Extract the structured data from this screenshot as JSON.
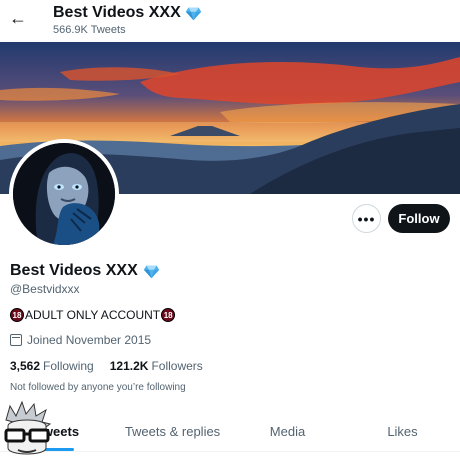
{
  "header": {
    "back_icon": "arrow-left-icon",
    "name": "Best Videos XXX",
    "tweet_count": "566.9K Tweets"
  },
  "profile": {
    "display_name": "Best Videos XXX",
    "verified_icon": "diamond-icon",
    "handle": "@Bestvidxxx",
    "bio_badge_left": "18",
    "bio_text": "ADULT ONLY ACCOUNT",
    "bio_badge_right": "18",
    "joined": "Joined November 2015",
    "joined_icon": "calendar-icon",
    "following_count": "3,562",
    "following_label": "Following",
    "followers_count": "121.2K",
    "followers_label": "Followers",
    "not_followed": "Not followed by anyone you’re following"
  },
  "actions": {
    "more_label": "•••",
    "follow_label": "Follow"
  },
  "tabs": [
    {
      "label": "Tweets",
      "active": true
    },
    {
      "label": "Tweets & replies",
      "active": false
    },
    {
      "label": "Media",
      "active": false
    },
    {
      "label": "Likes",
      "active": false
    }
  ],
  "colors": {
    "accent": "#1d9bf0",
    "text": "#0f1419",
    "muted": "#536471",
    "diamond": "#4fb3ee",
    "badge": "#6d0b1b"
  }
}
